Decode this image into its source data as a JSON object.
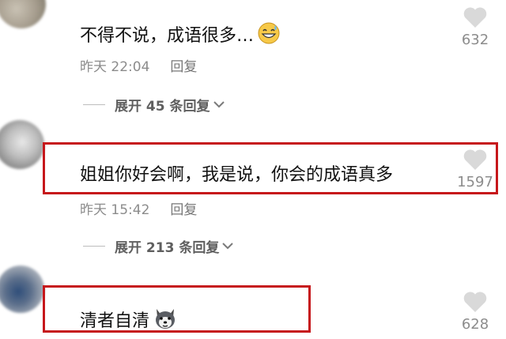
{
  "comments": [
    {
      "text": "不得不说，成语很多…",
      "emoji": "grinning-sweat-emoji",
      "time": "昨天 22:04",
      "reply_label": "回复",
      "likes": "632",
      "expand": "展开 45 条回复"
    },
    {
      "text": "姐姐你好会啊，我是说，你会的成语真多",
      "time": "昨天 15:42",
      "reply_label": "回复",
      "likes": "1597",
      "expand": "展开 213 条回复"
    },
    {
      "text": "清者自清",
      "emoji": "husky-dog-emoji",
      "likes": "628"
    }
  ],
  "colors": {
    "highlight_box": "#c6171b",
    "meta_text": "#8c8c8c",
    "heart": "#d9d9d9"
  }
}
